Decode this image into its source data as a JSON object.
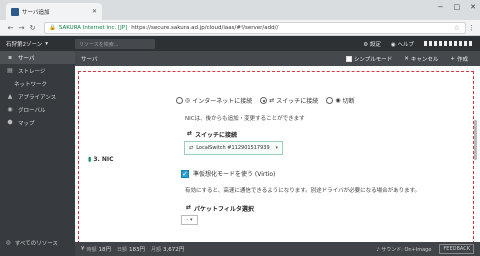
{
  "browser": {
    "tab_title": "サーバ追加",
    "window_controls": [
      "−",
      "□",
      "✕"
    ],
    "secure_label": "SAKURA Internet Inc. [JP]",
    "url": "https://secure.sakura.ad.jp/cloud/iaas/#!/server/add//"
  },
  "header": {
    "zone": "石狩第2ゾーン",
    "zone_caret": "▾",
    "search_placeholder": "リソースを検索...",
    "settings": "設定",
    "help": "ヘルプ"
  },
  "sidebar": {
    "items": [
      {
        "icon": "server-icon",
        "glyph": "▪",
        "label": "サーバ"
      },
      {
        "icon": "storage-icon",
        "glyph": "▤",
        "label": "ストレージ"
      },
      {
        "icon": "network-icon",
        "glyph": "",
        "label": "ネットワーク"
      },
      {
        "icon": "appliance-icon",
        "glyph": "▲",
        "label": "アプライアンス"
      },
      {
        "icon": "global-icon",
        "glyph": "◉",
        "label": "グローバル"
      },
      {
        "icon": "map-icon",
        "glyph": "⬢",
        "label": "マップ"
      }
    ],
    "all_resources": "すべてのリソース"
  },
  "content_header": {
    "title": "サーバ",
    "simple_mode": "シンプルモード",
    "cancel": "キャンセル",
    "create": "作成"
  },
  "form": {
    "section": "3. NIC",
    "radio_internet": "インターネットに接続",
    "radio_switch": "スイッチに接続",
    "radio_none": "切断",
    "nic_note": "NICは、後からも追加・変更することができます",
    "switch_label": "スイッチに接続",
    "switch_value": "LocalSwitch #112901517939",
    "virtio_label": "準仮想化モードを使う (Virtio)",
    "virtio_note": "有効にすると、高速に通信できるようになります。別途ドライバが必要になる場合があります。",
    "packet_filter_label": "パケットフィルタ選択",
    "packet_filter_value": "-"
  },
  "footer": {
    "hourly_label": "時額",
    "hourly": "18円",
    "daily_label": "日額",
    "daily": "183円",
    "monthly_label": "月額",
    "monthly": "3,672円",
    "sound": "サウンド: On+Image",
    "feedback": "FEEDBACK"
  }
}
